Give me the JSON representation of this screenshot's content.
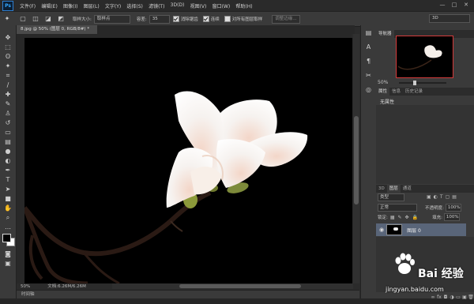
{
  "app": {
    "logo_text": "Ps"
  },
  "menu": [
    "文件(F)",
    "编辑(E)",
    "图像(I)",
    "图层(L)",
    "文字(Y)",
    "选择(S)",
    "滤镜(T)",
    "3D(D)",
    "视图(V)",
    "窗口(W)",
    "帮助(H)"
  ],
  "window_controls": {
    "minimize": "—",
    "maximize": "□",
    "close": "✕"
  },
  "options_bar": {
    "sample_size_label": "取样大小:",
    "sample_size_value": "取样点",
    "tolerance_label": "容差:",
    "tolerance_value": "35",
    "anti_alias_label": "消除锯齿",
    "contiguous_label": "连续",
    "all_layers_label": "对所有图层取样",
    "refine_edge_label": "调整边缘...",
    "workspace_value": "3D",
    "anti_alias_checked": true,
    "contiguous_checked": true,
    "all_layers_checked": false
  },
  "document": {
    "tab_title": "8.jpg @ 50% (图层 0, RGB/8#) *",
    "zoom": "50%",
    "doc_size": "文档:6.26M/6.26M",
    "timeline_label": "时间轴"
  },
  "navigator": {
    "tabs": [
      "导航器"
    ],
    "zoom": "50%"
  },
  "properties": {
    "tabs": [
      "属性",
      "信息",
      "历史记录"
    ],
    "empty_label": "无属性"
  },
  "layers": {
    "tabs": [
      "3D",
      "图层",
      "通道"
    ],
    "kind_label": "类型",
    "blend_mode": "正常",
    "opacity_label": "不透明度:",
    "opacity_value": "100%",
    "lock_label": "锁定:",
    "fill_label": "填充:",
    "fill_value": "100%",
    "items": [
      {
        "name": "图层 0"
      }
    ]
  },
  "watermark": {
    "text": "Bai 经验",
    "url": "jingyan.baidu.com"
  },
  "colors": {
    "ui_dark": "#2b2b2b",
    "panel": "#3a3a3a",
    "selected_layer": "#596579",
    "navigator_border": "#d53a3a",
    "ps_blue": "#34a8ff"
  }
}
